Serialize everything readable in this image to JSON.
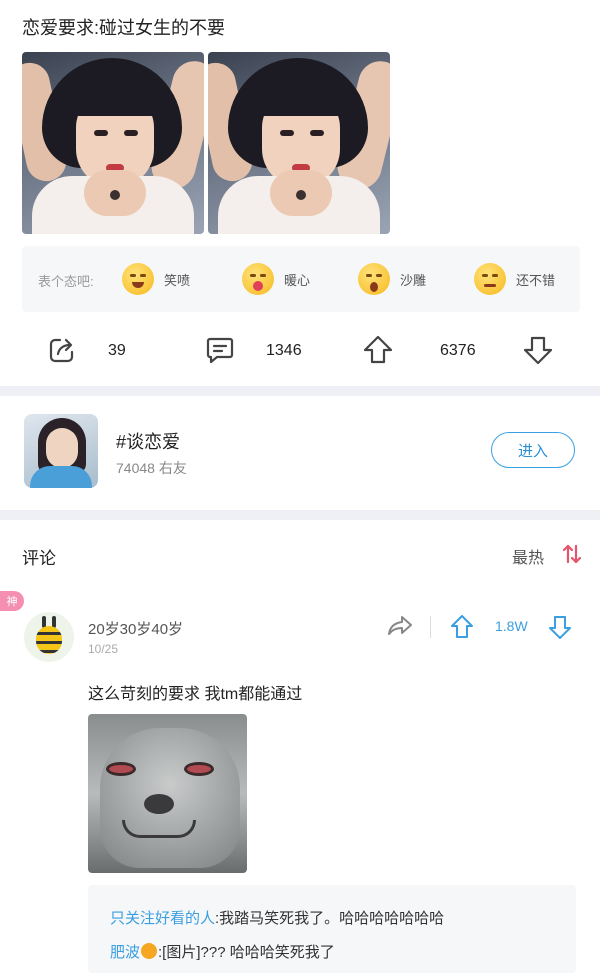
{
  "post": {
    "title": "恋爱要求:碰过女生的不要"
  },
  "reactions": {
    "label": "表个态吧:",
    "items": [
      {
        "icon": "laugh-cry-emoji",
        "label": "笑喷"
      },
      {
        "icon": "heart-hug-emoji",
        "label": "暖心"
      },
      {
        "icon": "silly-face-emoji",
        "label": "沙雕"
      },
      {
        "icon": "smirk-emoji",
        "label": "还不错"
      }
    ]
  },
  "actions": {
    "share_count": "39",
    "comment_count": "1346",
    "upvote_count": "6376"
  },
  "topic": {
    "name": "#谈恋爱",
    "members": "74048 右友",
    "enter_label": "进入"
  },
  "comments": {
    "title": "评论",
    "sort_label": "最热",
    "items": [
      {
        "badge": "神",
        "user": "20岁30岁40岁",
        "date": "10/25",
        "likes": "1.8W",
        "text": "这么苛刻的要求 我tm都能通过",
        "replies": [
          {
            "name": "只关注好看的人",
            "text": ":我踏马笑死我了。哈哈哈哈哈哈哈"
          },
          {
            "name": "肥波",
            "text": ":[图片]??? 哈哈哈笑死我了"
          }
        ]
      }
    ]
  },
  "colors": {
    "accent": "#3a9fe0",
    "badge": "#f48fb1",
    "divider": "#eef0f6",
    "sort_icon": "#e5556a"
  }
}
